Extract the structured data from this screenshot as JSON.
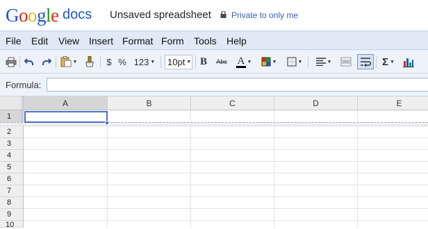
{
  "header": {
    "logo_letters": [
      "G",
      "o",
      "o",
      "g",
      "l",
      "e"
    ],
    "logo_product": "docs",
    "doc_title": "Unsaved spreadsheet",
    "privacy": "Private to only me"
  },
  "menu": [
    "File",
    "Edit",
    "View",
    "Insert",
    "Format",
    "Form",
    "Tools",
    "Help"
  ],
  "toolbar": {
    "currency": "$",
    "percent": "%",
    "number_format": "123",
    "font_size": "10pt",
    "bold": "B",
    "strikethrough": "Abc",
    "text_color_glyph": "A",
    "sum_glyph": "Σ",
    "icons": [
      "print-icon",
      "undo-icon",
      "redo-icon",
      "paste-icon",
      "paint-format-icon",
      "text-color-icon",
      "fill-color-icon",
      "borders-icon",
      "align-icon",
      "merge-icon",
      "wrap-icon",
      "sum-icon",
      "chart-icon"
    ]
  },
  "formula": {
    "label": "Formula:",
    "value": ""
  },
  "grid": {
    "columns": [
      "A",
      "B",
      "C",
      "D",
      "E"
    ],
    "rows": [
      "1",
      "2",
      "3",
      "4",
      "5",
      "6",
      "7",
      "8",
      "9",
      "10"
    ],
    "selected_column": "A",
    "selected_row": "1"
  },
  "colors": {
    "menubar_bg": "#e1e9f7",
    "toolbar_bg": "#eef2fa",
    "selection": "#4a6fc7",
    "logo_blue": "#1a55d8",
    "logo_red": "#d62a18",
    "logo_yellow": "#e8b818",
    "logo_green": "#229a2a"
  }
}
